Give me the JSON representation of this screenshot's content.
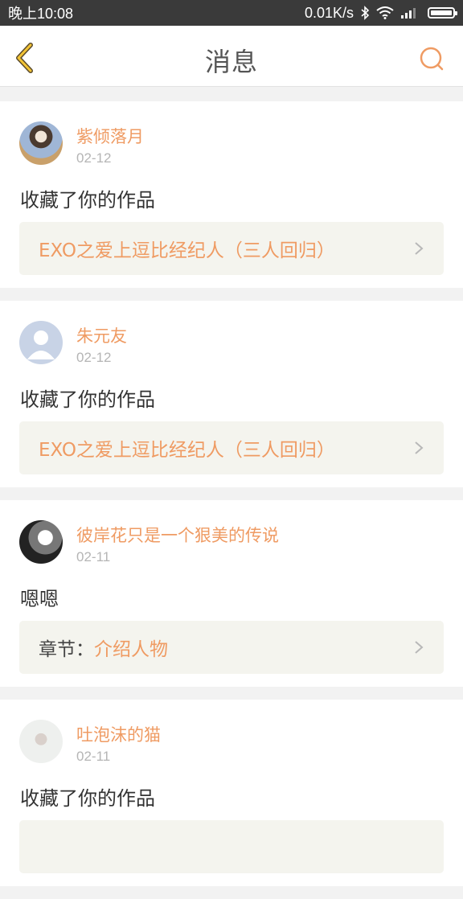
{
  "status_bar": {
    "time": "晚上10:08",
    "network_speed": "0.01K/s",
    "icons": [
      "bluetooth-icon",
      "wifi-icon",
      "signal-icon",
      "battery-icon"
    ]
  },
  "nav": {
    "title": "消息",
    "back_icon": "chevron-left-icon",
    "search_icon": "search-icon",
    "accent_color": "#ef9b63"
  },
  "messages": [
    {
      "username": "紫倾落月",
      "date": "02-12",
      "content": "收藏了你的作品",
      "work_prefix": "",
      "work_title": "EXO之爱上逗比经纪人（三人回归）"
    },
    {
      "username": "朱元友",
      "date": "02-12",
      "content": "收藏了你的作品",
      "work_prefix": "",
      "work_title": "EXO之爱上逗比经纪人（三人回归）"
    },
    {
      "username": "彼岸花只是一个狠美的传说",
      "date": "02-11",
      "content": "嗯嗯",
      "work_prefix": "章节：",
      "work_title": "介绍人物"
    },
    {
      "username": "吐泡沫的猫",
      "date": "02-11",
      "content": "收藏了你的作品",
      "work_prefix": "",
      "work_title": ""
    }
  ]
}
